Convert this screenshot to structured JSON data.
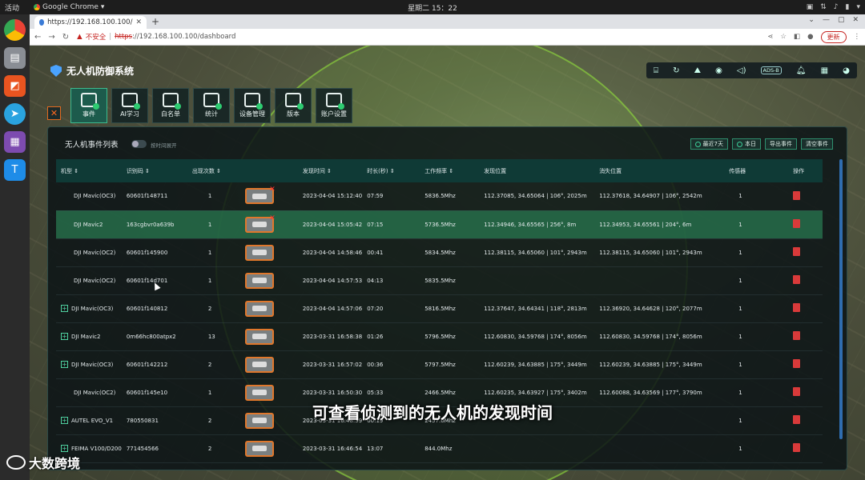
{
  "os": {
    "activities": "活动",
    "app_name": "Google Chrome",
    "clock": "星期二 15：22"
  },
  "browser": {
    "tab_title": "https://192.168.100.100/",
    "insecure": "不安全",
    "url_scheme": "https",
    "url_rest": "://192.168.100.100/dashboard",
    "update_label": "更新"
  },
  "app": {
    "title": "无人机防御系统"
  },
  "menu": [
    {
      "label": "事件"
    },
    {
      "label": "AI学习"
    },
    {
      "label": "白名单"
    },
    {
      "label": "统计"
    },
    {
      "label": "设备管理"
    },
    {
      "label": "版本"
    },
    {
      "label": "账户设置"
    }
  ],
  "panel": {
    "title": "无人机事件列表",
    "toggle_label": "按时间展开",
    "buttons": {
      "last7": "最近7天",
      "today": "本日",
      "export": "导出事件",
      "clear": "清空事件"
    }
  },
  "columns": [
    "机型",
    "识别码",
    "出现次数",
    "",
    "发现时间",
    "时长(秒)",
    "工作频率",
    "发现位置",
    "消失位置",
    "传感器",
    "操作"
  ],
  "rows": [
    {
      "model": "DJI Mavic(OC3)",
      "id": "60601f148711",
      "count": "1",
      "time": "2023-04-04 15:12:40",
      "dur": "07:59",
      "freq": "5836.5Mhz",
      "found": "112.37085, 34.65064 | 106°, 2025m",
      "lost": "112.37618, 34.64907 | 106°, 2542m",
      "sensor": "1",
      "expand": false,
      "hl": false
    },
    {
      "model": "DJI Mavic2",
      "id": "163cgbvr0a639b",
      "count": "1",
      "time": "2023-04-04 15:05:42",
      "dur": "07:15",
      "freq": "5736.5Mhz",
      "found": "112.34946, 34.65565 | 256°, 8m",
      "lost": "112.34953, 34.65561 | 204°, 6m",
      "sensor": "1",
      "expand": false,
      "hl": true
    },
    {
      "model": "DJI Mavic(OC2)",
      "id": "60601f145900",
      "count": "1",
      "time": "2023-04-04 14:58:46",
      "dur": "00:41",
      "freq": "5834.5Mhz",
      "found": "112.38115, 34.65060 | 101°, 2943m",
      "lost": "112.38115, 34.65060 | 101°, 2943m",
      "sensor": "1",
      "expand": false,
      "hl": false
    },
    {
      "model": "DJI Mavic(OC2)",
      "id": "60601f14d701",
      "count": "1",
      "time": "2023-04-04 14:57:53",
      "dur": "04:13",
      "freq": "5835.5Mhz",
      "found": "",
      "lost": "",
      "sensor": "1",
      "expand": false,
      "hl": false
    },
    {
      "model": "DJI Mavic(OC3)",
      "id": "60601f140812",
      "count": "2",
      "time": "2023-04-04 14:57:06",
      "dur": "07:20",
      "freq": "5816.5Mhz",
      "found": "112.37647, 34.64341 | 118°, 2813m",
      "lost": "112.36920, 34.64628 | 120°, 2077m",
      "sensor": "1",
      "expand": true,
      "hl": false
    },
    {
      "model": "DJI Mavic2",
      "id": "0m66hc800atpx2",
      "count": "13",
      "time": "2023-03-31 16:58:38",
      "dur": "01:26",
      "freq": "5796.5Mhz",
      "found": "112.60830, 34.59768 | 174°, 8056m",
      "lost": "112.60830, 34.59768 | 174°, 8056m",
      "sensor": "1",
      "expand": true,
      "hl": false
    },
    {
      "model": "DJI Mavic(OC3)",
      "id": "60601f142212",
      "count": "2",
      "time": "2023-03-31 16:57:02",
      "dur": "00:36",
      "freq": "5797.5Mhz",
      "found": "112.60239, 34.63885 | 175°, 3449m",
      "lost": "112.60239, 34.63885 | 175°, 3449m",
      "sensor": "1",
      "expand": true,
      "hl": false
    },
    {
      "model": "DJI Mavic(OC2)",
      "id": "60601f145e10",
      "count": "1",
      "time": "2023-03-31 16:50:30",
      "dur": "05:33",
      "freq": "2466.5Mhz",
      "found": "112.60235, 34.63927 | 175°, 3402m",
      "lost": "112.60088, 34.63569 | 177°, 3790m",
      "sensor": "1",
      "expand": false,
      "hl": false
    },
    {
      "model": "AUTEL EVO_V1",
      "id": "780550831",
      "count": "2",
      "time": "2023-03-31 16:48:59",
      "dur": "00:19",
      "freq": "2457.0Mhz",
      "found": "",
      "lost": "",
      "sensor": "1",
      "expand": true,
      "hl": false
    },
    {
      "model": "FEIMA V100/D200",
      "id": "771454566",
      "count": "2",
      "time": "2023-03-31 16:46:54",
      "dur": "13:07",
      "freq": "844.0Mhz",
      "found": "",
      "lost": "",
      "sensor": "1",
      "expand": true,
      "hl": false
    }
  ],
  "caption": "可查看侦测到的无人机的发现时间",
  "watermark": "大数跨境",
  "colors": {
    "accent": "#3dbb8e",
    "highlight_row": "#287850",
    "danger": "#d93a3a",
    "thumb_border": "#e0772b"
  }
}
